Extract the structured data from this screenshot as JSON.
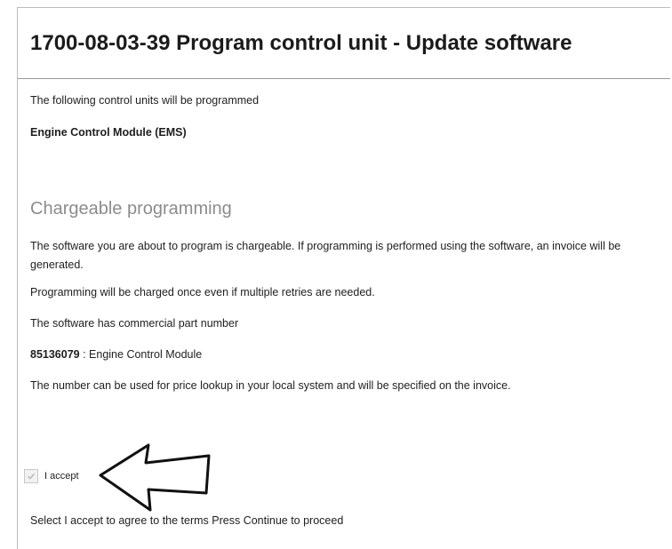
{
  "header": {
    "title": "1700-08-03-39 Program control unit - Update software"
  },
  "content": {
    "intro": "The following control units will be programmed",
    "control_unit": "Engine Control Module (EMS)",
    "section_heading": "Chargeable programming",
    "para_chargeable": "The software you are about to program is chargeable. If programming is performed using the software, an invoice will be generated.",
    "para_retries": "Programming will be charged once even if multiple retries are needed.",
    "para_part_intro": "The software has commercial part number",
    "part_number": "85136079",
    "part_desc": " : Engine Control Module",
    "para_price": "The number can be used for price lookup in your local system and will be specified on the invoice.",
    "accept_label": "I accept",
    "accept_checked": true,
    "instruction": "Select I accept to agree to the terms Press Continue to proceed"
  },
  "icons": {
    "check": "check-icon",
    "arrow": "left-arrow-annotation"
  }
}
